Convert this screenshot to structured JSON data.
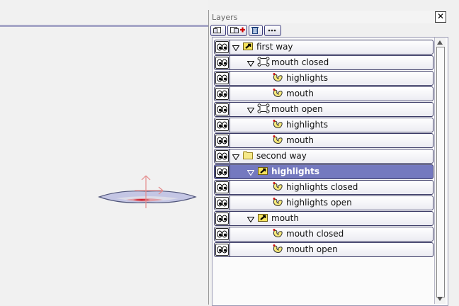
{
  "panel": {
    "title": "Layers"
  },
  "toolbar": {
    "buttons": [
      {
        "name": "new-layer-button",
        "icon": "new-layer-icon"
      },
      {
        "name": "new-group-button",
        "icon": "new-group-icon"
      },
      {
        "name": "delete-layer-button",
        "icon": "trash-icon"
      },
      {
        "name": "more-options-button",
        "icon": "ellipsis-icon"
      }
    ]
  },
  "colors": {
    "selection": "#7479bf",
    "border": "#3b3b66",
    "guide": "#a7a7c8"
  },
  "layers": [
    {
      "label": "first way",
      "depth": 0,
      "icon": "switch-icon",
      "expanded": true
    },
    {
      "label": "mouth closed",
      "depth": 1,
      "icon": "bone-icon",
      "expanded": true
    },
    {
      "label": "highlights",
      "depth": 2,
      "icon": "vector-icon"
    },
    {
      "label": "mouth",
      "depth": 2,
      "icon": "vector-icon"
    },
    {
      "label": "mouth open",
      "depth": 1,
      "icon": "bone-icon",
      "expanded": true
    },
    {
      "label": "highlights",
      "depth": 2,
      "icon": "vector-icon"
    },
    {
      "label": "mouth",
      "depth": 2,
      "icon": "vector-icon"
    },
    {
      "label": "second way",
      "depth": 0,
      "icon": "folder-icon",
      "expanded": true
    },
    {
      "label": "highlights",
      "depth": 1,
      "icon": "switch-icon",
      "expanded": true,
      "selected": true
    },
    {
      "label": "highlights closed",
      "depth": 2,
      "icon": "vector-icon"
    },
    {
      "label": "highlights open",
      "depth": 2,
      "icon": "vector-icon"
    },
    {
      "label": "mouth",
      "depth": 1,
      "icon": "switch-icon",
      "expanded": true
    },
    {
      "label": "mouth closed",
      "depth": 2,
      "icon": "vector-icon"
    },
    {
      "label": "mouth open",
      "depth": 2,
      "icon": "vector-icon"
    }
  ]
}
